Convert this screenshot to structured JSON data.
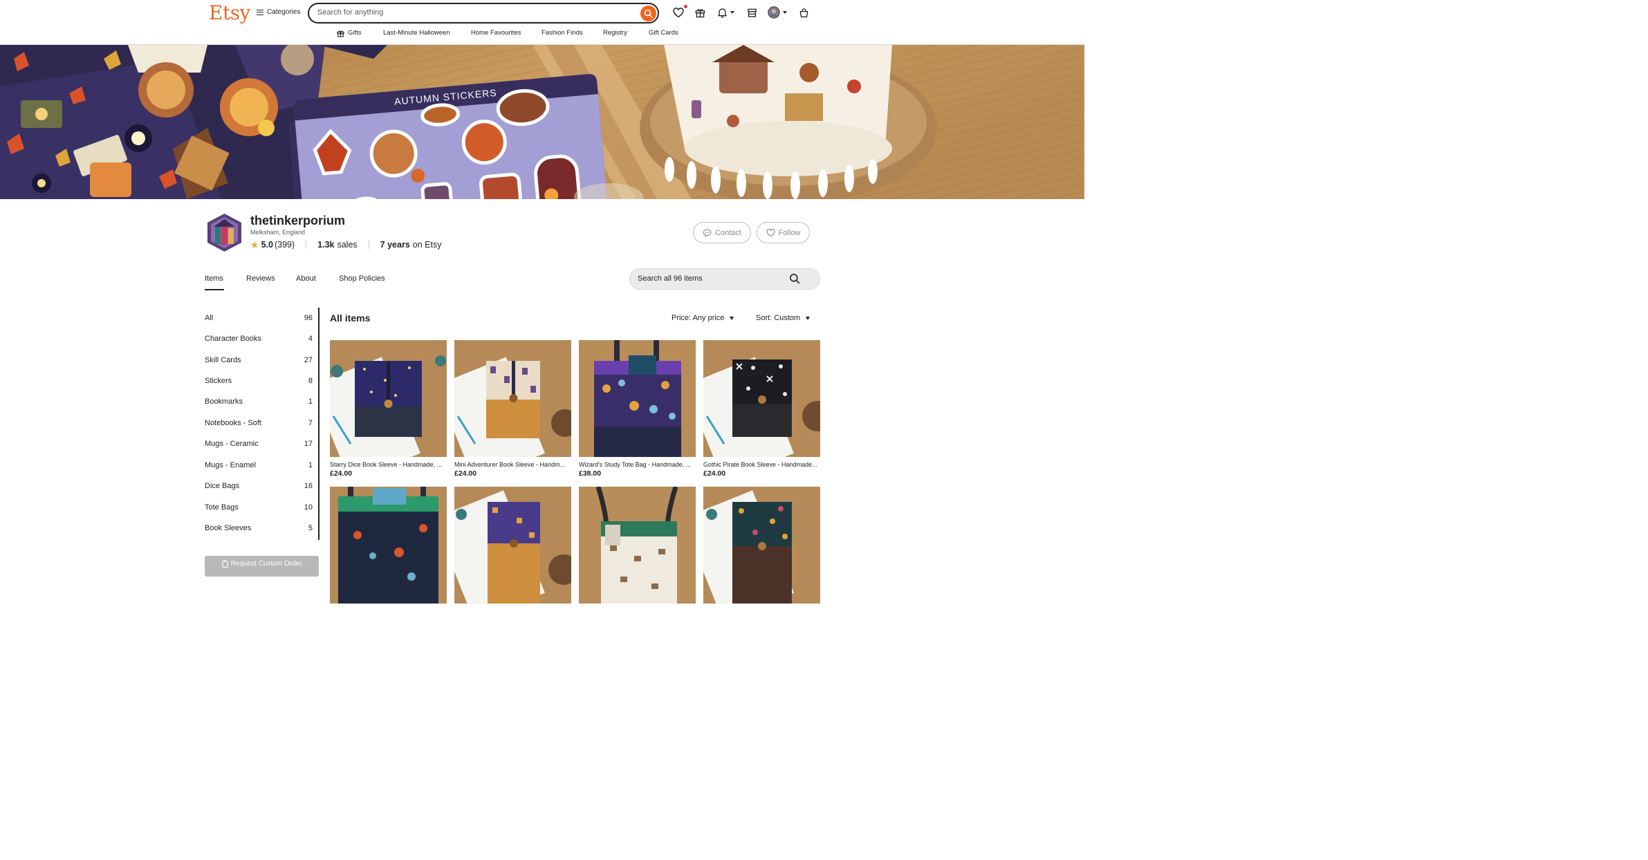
{
  "header": {
    "logo": "Etsy",
    "categories_label": "Categories",
    "search_placeholder": "Search for anything",
    "subnav": [
      "Gifts",
      "Last-Minute Halloween",
      "Home Favourites",
      "Fashion Finds",
      "Registry",
      "Gift Cards"
    ]
  },
  "banner": {
    "sticker_sheet_title": "AUTUMN STICKERS"
  },
  "shop": {
    "name": "thetinkerporium",
    "location": "Melksham, England",
    "rating": "5.0",
    "reviews": "(399)",
    "sales_count": "1.3k",
    "sales_label": "sales",
    "years": "7 years",
    "years_suffix": "on Etsy",
    "contact_label": "Contact",
    "follow_label": "Follow"
  },
  "tabs": [
    "Items",
    "Reviews",
    "About",
    "Shop Policies"
  ],
  "shop_search_placeholder": "Search all 96 items",
  "sidebar": [
    {
      "label": "All",
      "count": "96"
    },
    {
      "label": "Character Books",
      "count": "4"
    },
    {
      "label": "Skill Cards",
      "count": "27"
    },
    {
      "label": "Stickers",
      "count": "8"
    },
    {
      "label": "Bookmarks",
      "count": "1"
    },
    {
      "label": "Notebooks - Soft",
      "count": "7"
    },
    {
      "label": "Mugs - Ceramic",
      "count": "17"
    },
    {
      "label": "Mugs - Enamel",
      "count": "1"
    },
    {
      "label": "Dice Bags",
      "count": "16"
    },
    {
      "label": "Tote Bags",
      "count": "10"
    },
    {
      "label": "Book Sleeves",
      "count": "5"
    }
  ],
  "request_custom_order": "Request Custom Order",
  "main": {
    "title": "All items",
    "price_filter": "Price: Any price",
    "sort": "Sort: Custom"
  },
  "listings": [
    {
      "title": "Starry Dice Book Sleeve - Handmade, ...",
      "price": "£24.00"
    },
    {
      "title": "Mini Adventurer Book Sleeve - Handm...",
      "price": "£24.00"
    },
    {
      "title": "Wizard's Study Tote Bag - Handmade, ...",
      "price": "£38.00"
    },
    {
      "title": "Gothic Pirate Book Sleeve - Handmade...",
      "price": "£24.00"
    }
  ],
  "colors": {
    "brand": "#f1641e",
    "text": "#222222",
    "muted": "#595959",
    "star": "#f1a51e"
  }
}
